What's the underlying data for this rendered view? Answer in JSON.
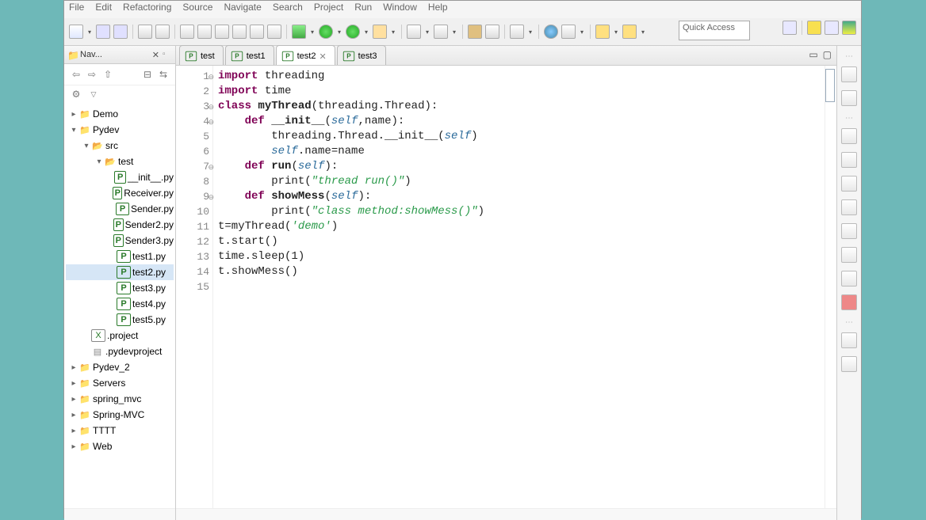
{
  "menu": [
    "File",
    "Edit",
    "Refactoring",
    "Source",
    "Navigate",
    "Search",
    "Project",
    "Run",
    "Window",
    "Help"
  ],
  "quick_access": "Quick Access",
  "navigator": {
    "title": "Nav...",
    "tree": [
      {
        "depth": 0,
        "exp": "▸",
        "icon": "proj",
        "label": "Demo"
      },
      {
        "depth": 0,
        "exp": "▾",
        "icon": "proj",
        "label": "Pydev"
      },
      {
        "depth": 1,
        "exp": "▾",
        "icon": "folder",
        "label": "src"
      },
      {
        "depth": 2,
        "exp": "▾",
        "icon": "folder",
        "label": "test"
      },
      {
        "depth": 3,
        "exp": "",
        "icon": "py",
        "label": "__init__.py"
      },
      {
        "depth": 3,
        "exp": "",
        "icon": "py",
        "label": "Receiver.py"
      },
      {
        "depth": 3,
        "exp": "",
        "icon": "py",
        "label": "Sender.py"
      },
      {
        "depth": 3,
        "exp": "",
        "icon": "py",
        "label": "Sender2.py"
      },
      {
        "depth": 3,
        "exp": "",
        "icon": "py",
        "label": "Sender3.py"
      },
      {
        "depth": 3,
        "exp": "",
        "icon": "py",
        "label": "test1.py"
      },
      {
        "depth": 3,
        "exp": "",
        "icon": "py",
        "label": "test2.py",
        "selected": true
      },
      {
        "depth": 3,
        "exp": "",
        "icon": "py",
        "label": "test3.py"
      },
      {
        "depth": 3,
        "exp": "",
        "icon": "py",
        "label": "test4.py"
      },
      {
        "depth": 3,
        "exp": "",
        "icon": "py",
        "label": "test5.py"
      },
      {
        "depth": 1,
        "exp": "",
        "icon": "x",
        "label": ".project"
      },
      {
        "depth": 1,
        "exp": "",
        "icon": "file",
        "label": ".pydevproject"
      },
      {
        "depth": 0,
        "exp": "▸",
        "icon": "proj",
        "label": "Pydev_2"
      },
      {
        "depth": 0,
        "exp": "▸",
        "icon": "proj",
        "label": "Servers"
      },
      {
        "depth": 0,
        "exp": "▸",
        "icon": "proj",
        "label": "spring_mvc"
      },
      {
        "depth": 0,
        "exp": "▸",
        "icon": "proj",
        "label": "Spring-MVC"
      },
      {
        "depth": 0,
        "exp": "▸",
        "icon": "proj",
        "label": "TTTT"
      },
      {
        "depth": 0,
        "exp": "▸",
        "icon": "proj",
        "label": "Web"
      }
    ]
  },
  "tabs": [
    {
      "label": "test",
      "icon": "py",
      "active": false
    },
    {
      "label": "test1",
      "icon": "py",
      "active": false
    },
    {
      "label": "test2",
      "icon": "py",
      "active": true,
      "closable": true
    },
    {
      "label": "test3",
      "icon": "py",
      "active": false
    }
  ],
  "code": {
    "lines": [
      {
        "n": 1,
        "fold": "⊖",
        "tokens": [
          [
            "kw",
            "import"
          ],
          [
            "",
            " threading"
          ]
        ]
      },
      {
        "n": 2,
        "tokens": [
          [
            "kw",
            "import"
          ],
          [
            "",
            " time"
          ]
        ]
      },
      {
        "n": 3,
        "fold": "⊖",
        "tokens": [
          [
            "kw",
            "class"
          ],
          [
            "",
            " "
          ],
          [
            "fn",
            "myThread"
          ],
          [
            "",
            "(threading.Thread):"
          ]
        ]
      },
      {
        "n": 4,
        "fold": "⊖",
        "tokens": [
          [
            "",
            "    "
          ],
          [
            "kw",
            "def"
          ],
          [
            "",
            " "
          ],
          [
            "fn",
            "__init__"
          ],
          [
            "",
            "("
          ],
          [
            "self",
            "self"
          ],
          [
            "",
            ",name):"
          ]
        ]
      },
      {
        "n": 5,
        "tokens": [
          [
            "",
            "        threading.Thread.__init__("
          ],
          [
            "self",
            "self"
          ],
          [
            "",
            ")"
          ]
        ]
      },
      {
        "n": 6,
        "tokens": [
          [
            "",
            "        "
          ],
          [
            "self",
            "self"
          ],
          [
            "",
            ".name=name"
          ]
        ]
      },
      {
        "n": 7,
        "fold": "⊖",
        "tokens": [
          [
            "",
            "    "
          ],
          [
            "kw",
            "def"
          ],
          [
            "",
            " "
          ],
          [
            "fn",
            "run"
          ],
          [
            "",
            "("
          ],
          [
            "self",
            "self"
          ],
          [
            "",
            "):"
          ]
        ]
      },
      {
        "n": 8,
        "tokens": [
          [
            "",
            "        print("
          ],
          [
            "str",
            "\"thread run()\""
          ],
          [
            "",
            ")"
          ]
        ]
      },
      {
        "n": 9,
        "fold": "⊖",
        "tokens": [
          [
            "",
            "    "
          ],
          [
            "kw",
            "def"
          ],
          [
            "",
            " "
          ],
          [
            "fn",
            "showMess"
          ],
          [
            "",
            "("
          ],
          [
            "self",
            "self"
          ],
          [
            "",
            "):"
          ]
        ]
      },
      {
        "n": 10,
        "tokens": [
          [
            "",
            "        print("
          ],
          [
            "str",
            "\"class method:showMess()\""
          ],
          [
            "",
            ")"
          ]
        ]
      },
      {
        "n": 11,
        "tokens": [
          [
            "",
            ""
          ]
        ]
      },
      {
        "n": 12,
        "tokens": [
          [
            "",
            "t=myThread("
          ],
          [
            "str",
            "'demo'"
          ],
          [
            "",
            ")"
          ]
        ]
      },
      {
        "n": 13,
        "tokens": [
          [
            "",
            "t.start()"
          ]
        ]
      },
      {
        "n": 14,
        "tokens": [
          [
            "",
            "time.sleep(1)"
          ]
        ]
      },
      {
        "n": 15,
        "tokens": [
          [
            "",
            "t.showMess()"
          ]
        ],
        "caret": true
      }
    ]
  }
}
